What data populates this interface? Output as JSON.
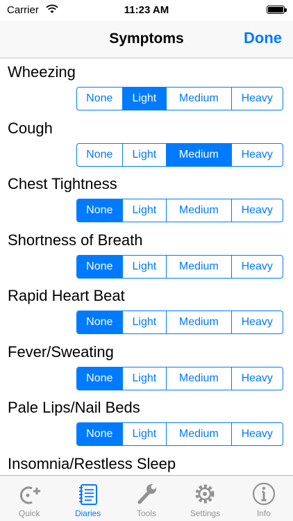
{
  "status_bar": {
    "carrier": "Carrier",
    "time": "11:23 AM"
  },
  "nav": {
    "title": "Symptoms",
    "done_label": "Done"
  },
  "segment_labels": [
    "None",
    "Light",
    "Medium",
    "Heavy"
  ],
  "symptoms": [
    {
      "label": "Wheezing",
      "selected": "Light"
    },
    {
      "label": "Cough",
      "selected": "Medium"
    },
    {
      "label": "Chest Tightness",
      "selected": "None"
    },
    {
      "label": "Shortness of Breath",
      "selected": "None"
    },
    {
      "label": "Rapid Heart Beat",
      "selected": "None"
    },
    {
      "label": "Fever/Sweating",
      "selected": "None"
    },
    {
      "label": "Pale Lips/Nail Beds",
      "selected": "None"
    },
    {
      "label": "Insomnia/Restless Sleep",
      "selected": ""
    }
  ],
  "tab_bar": {
    "tabs": [
      {
        "label": "Quick",
        "icon": "quick-add-icon"
      },
      {
        "label": "Diaries",
        "icon": "diary-notebook-icon"
      },
      {
        "label": "Tools",
        "icon": "wrench-icon"
      },
      {
        "label": "Settings",
        "icon": "gear-icon"
      },
      {
        "label": "Info",
        "icon": "info-icon"
      }
    ],
    "active": "Diaries"
  },
  "colors": {
    "accent": "#007aff",
    "inactive_tab": "#929292"
  }
}
